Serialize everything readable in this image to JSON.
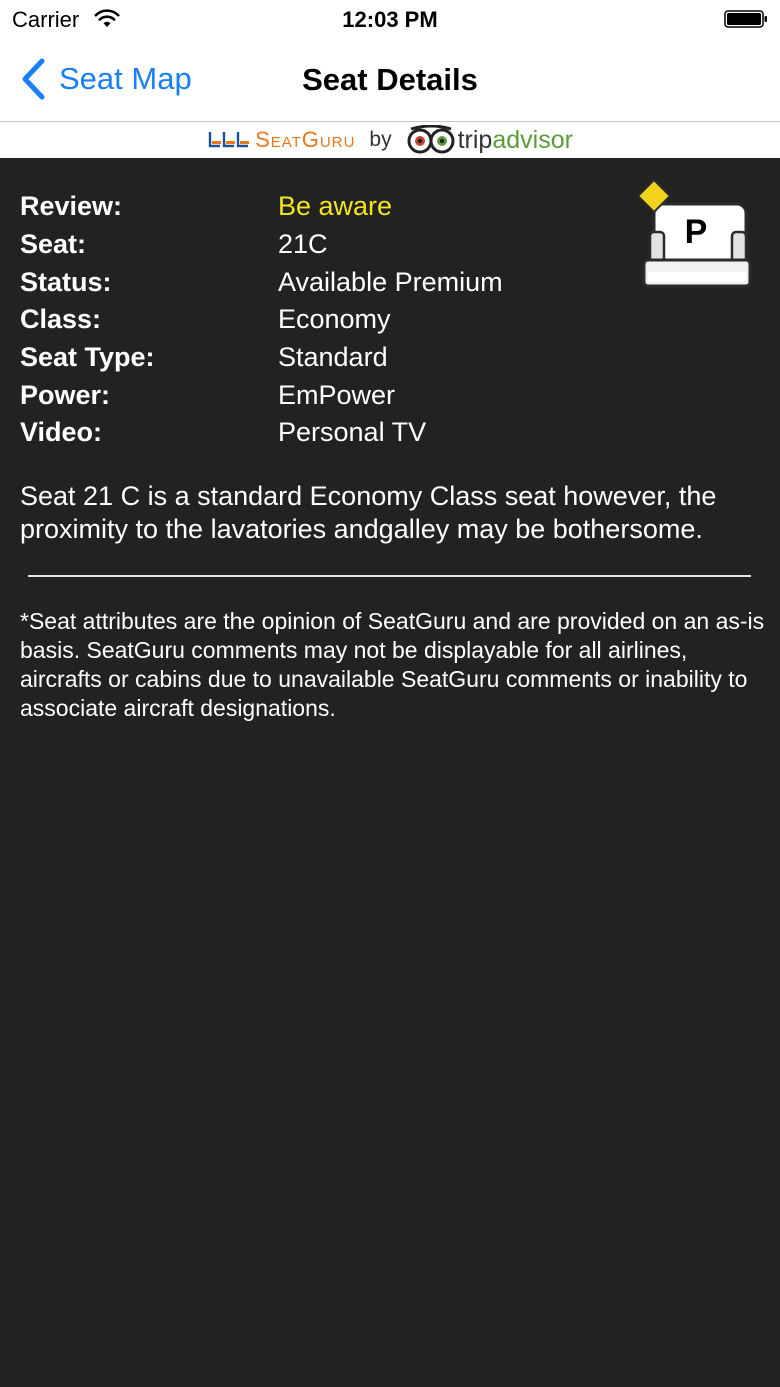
{
  "status_bar": {
    "carrier": "Carrier",
    "time": "12:03 PM",
    "wifi_icon": "wifi-icon",
    "battery_icon": "battery-icon"
  },
  "nav": {
    "back_label": "Seat Map",
    "title": "Seat Details",
    "accent_color": "#1a7ff5"
  },
  "banner": {
    "seatguru": "SeatGuru",
    "by": "by",
    "trip": "trip",
    "advisor": "advisor"
  },
  "details": [
    {
      "label": "Review:",
      "value": "Be aware"
    },
    {
      "label": "Seat:",
      "value": "21C"
    },
    {
      "label": "Status:",
      "value": "Available Premium"
    },
    {
      "label": "Class:",
      "value": "Economy"
    },
    {
      "label": "Seat Type:",
      "value": "Standard"
    },
    {
      "label": "Power:",
      "value": "EmPower"
    },
    {
      "label": "Video:",
      "value": "Personal TV"
    }
  ],
  "seat_badge": {
    "letter": "P",
    "review_color": "#f2e51f"
  },
  "description": "Seat 21 C is a standard Economy Class seat however, the proximity to the lavatories andgalley may be bothersome.",
  "disclaimer": "*Seat attributes are the opinion of SeatGuru and are provided on an as-is basis.  SeatGuru comments may not be displayable for all airlines, aircrafts or cabins due to unavailable SeatGuru comments or inability to associate aircraft designations."
}
